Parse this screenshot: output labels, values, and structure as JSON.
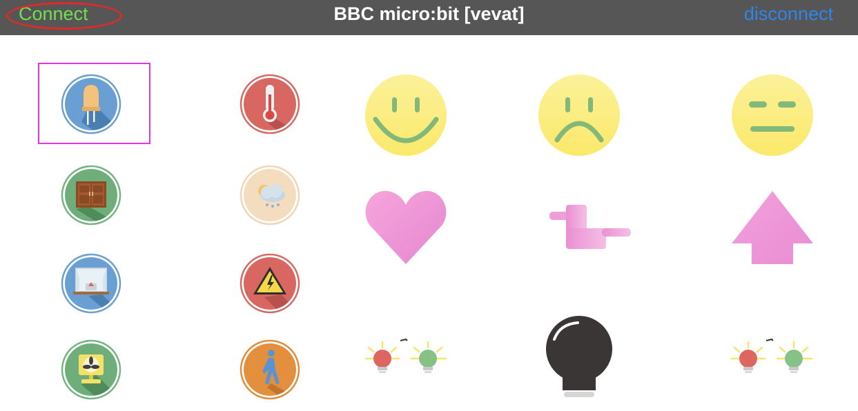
{
  "navbar": {
    "connect_label": "Connect",
    "title": "BBC micro:bit [vevat]",
    "disconnect_label": "disconnect"
  },
  "colors": {
    "navbar_bg": "#565656",
    "connect": "#6fe04e",
    "disconnect": "#2e86e8",
    "annotation": "#e02a2a",
    "selection": "#e334e3"
  },
  "controls": [
    {
      "icon": "led-icon",
      "selected": true
    },
    {
      "icon": "thermometer-icon"
    },
    {
      "icon": "happy-face-icon"
    },
    {
      "icon": "sad-face-icon"
    },
    {
      "icon": "neutral-face-icon"
    },
    {
      "icon": "cabinet-doors-icon"
    },
    {
      "icon": "weather-cloud-icon"
    },
    {
      "icon": "heart-icon"
    },
    {
      "icon": "duck-icon"
    },
    {
      "icon": "arrow-up-icon"
    },
    {
      "icon": "window-curtain-icon"
    },
    {
      "icon": "warning-icon"
    },
    {
      "icon": "traffic-lights-icon"
    },
    {
      "icon": "light-bulb-icon"
    },
    {
      "icon": "traffic-lights-icon"
    },
    {
      "icon": "fan-icon"
    },
    {
      "icon": "walking-person-icon"
    }
  ]
}
